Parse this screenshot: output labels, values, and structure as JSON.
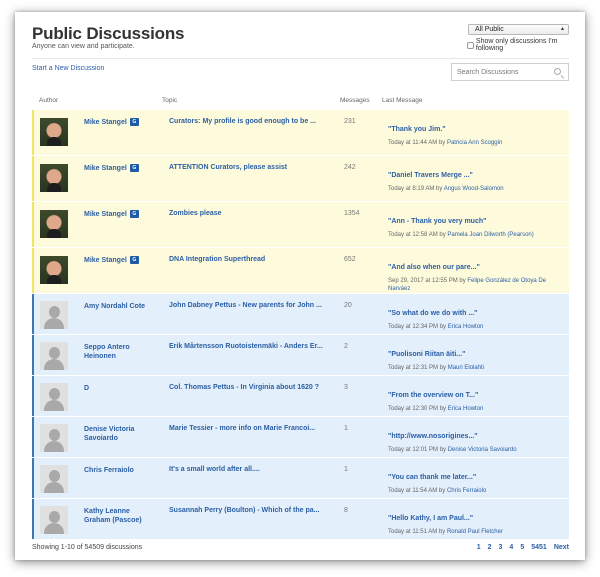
{
  "header": {
    "title": "Public Discussions",
    "subtitle": "Anyone can view and participate.",
    "filter_select": "All Public",
    "follow_checkbox_label": "Show only discussions I'm following",
    "new_discussion_link": "Start a New Discussion",
    "search_placeholder": "Search Discussions"
  },
  "columns": {
    "author": "Author",
    "topic": "Topic",
    "messages": "Messages",
    "last_message": "Last Message"
  },
  "rows": [
    {
      "author": "Mike Stangel",
      "badge": "G",
      "topic": "Curators: My profile is good enough to be ...",
      "messages": "231",
      "last_quote": "\"Thank you Jim.\"",
      "last_time": "Today at 11:44 AM by ",
      "last_by": "Patricia Ann Scoggin",
      "followed": true
    },
    {
      "author": "Mike Stangel",
      "badge": "G",
      "topic": "ATTENTION Curators, please assist",
      "messages": "242",
      "last_quote": "\"Daniel Travers Merge ...\"",
      "last_time": "Today at 8:19 AM by ",
      "last_by": "Angus Wood-Salomon",
      "followed": true
    },
    {
      "author": "Mike Stangel",
      "badge": "G",
      "topic": "Zombies please",
      "messages": "1354",
      "last_quote": "\"Ann - Thank you very much\"",
      "last_time": "Today at 12:58 AM by ",
      "last_by": "Pamela Joan Dilworth (Pearson)",
      "followed": true
    },
    {
      "author": "Mike Stangel",
      "badge": "G",
      "topic": "DNA Integration Superthread",
      "messages": "652",
      "last_quote": "\"And also when our pare...\"",
      "last_time": "Sep 29, 2017 at 12:55 PM by ",
      "last_by": "Felipe González de Otoya De Narváez",
      "followed": true
    },
    {
      "author": "Amy Nordahl Cote",
      "badge": "",
      "topic": "John Dabney Pettus - New parents for John ...",
      "messages": "20",
      "last_quote": "\"So what do we do with ...\"",
      "last_time": "Today at 12:34 PM by ",
      "last_by": "Erica Howton",
      "followed": false
    },
    {
      "author": "Seppo Antero Heinonen",
      "badge": "",
      "topic": "Erik Mårtensson Ruotoistenmäki - Anders Er...",
      "messages": "2",
      "last_quote": "\"Puolisoni Riitan äiti...\"",
      "last_time": "Today at 12:31 PM by ",
      "last_by": "Mauri Elolahti",
      "followed": false
    },
    {
      "author": "D",
      "badge": "",
      "topic": "Col. Thomas Pettus - In Virginia about 1620 ?",
      "messages": "3",
      "last_quote": "\"From the overview on T...\"",
      "last_time": "Today at 12:30 PM by ",
      "last_by": "Erica Howton",
      "followed": false
    },
    {
      "author": "Denise Victoria Savoiardo",
      "badge": "",
      "topic": "Marie Tessier - more info on Marie Francoi...",
      "messages": "1",
      "last_quote": "\"http://www.nosorigines...\"",
      "last_time": "Today at 12:01 PM by ",
      "last_by": "Denise Victoria Savoiardo",
      "followed": false
    },
    {
      "author": "Chris Ferraiolo",
      "badge": "",
      "topic": "It's a small world after all....",
      "messages": "1",
      "last_quote": "\"You can thank me later...\"",
      "last_time": "Today at 11:54 AM by ",
      "last_by": "Chris Ferraiolo",
      "followed": false
    },
    {
      "author": "Kathy Leanne Graham (Pascoe)",
      "badge": "",
      "topic": "Susannah Perry (Boulton) - Which of the pa...",
      "messages": "8",
      "last_quote": "\"Hello Kathy, I am Paul...\"",
      "last_time": "Today at 11:51 AM by ",
      "last_by": "Ronald Paul Fletcher",
      "followed": false
    }
  ],
  "footer": {
    "showing": "Showing 1-10 of 54509 discussions",
    "pages": [
      "1",
      "2",
      "3",
      "4",
      "5",
      "5451",
      "Next"
    ]
  },
  "colors": {
    "link": "#2b5fa5",
    "followed_bg": "#fefbdc",
    "followed_accent": "#f2e36a",
    "other_bg": "#e3effb",
    "other_accent": "#3a78b3",
    "badge": "#1f5aa6"
  }
}
